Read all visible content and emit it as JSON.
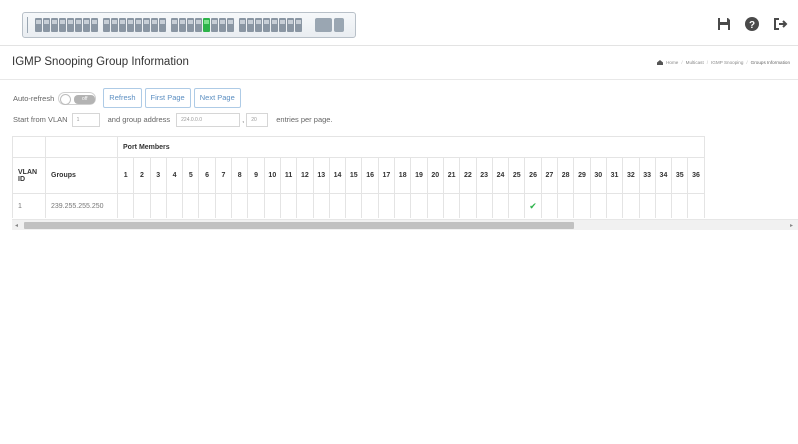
{
  "header": {
    "icons": [
      "save-icon",
      "help-icon",
      "logout-icon"
    ]
  },
  "page": {
    "title": "IGMP Snooping Group Information"
  },
  "breadcrumb": [
    "Home",
    "Multicast",
    "IGMP Snooping",
    "Groups Information"
  ],
  "controls": {
    "auto_refresh_label": "Auto-refresh",
    "toggle_state": "off",
    "refresh_label": "Refresh",
    "first_page_label": "First Page",
    "next_page_label": "Next Page",
    "start_vlan_label": "Start from VLAN",
    "start_vlan_value": "1",
    "group_address_label": "and group address",
    "group_address_value": "224.0.0.0",
    "comma": ",",
    "entries_value": "20",
    "entries_label": "entries per page."
  },
  "table": {
    "port_members_header": "Port Members",
    "vlan_header": "VLAN ID",
    "groups_header": "Groups",
    "ports": [
      "1",
      "2",
      "3",
      "4",
      "5",
      "6",
      "7",
      "8",
      "9",
      "10",
      "11",
      "12",
      "13",
      "14",
      "15",
      "16",
      "17",
      "18",
      "19",
      "20",
      "21",
      "22",
      "23",
      "24",
      "25",
      "26",
      "27",
      "28",
      "29",
      "30",
      "31",
      "32",
      "33",
      "34",
      "35",
      "36"
    ],
    "rows": [
      {
        "vlan": "1",
        "group": "239.255.255.250",
        "member_ports": [
          "26"
        ]
      }
    ]
  },
  "colors": {
    "accent": "#5c8fc2",
    "check": "#2db34a"
  }
}
